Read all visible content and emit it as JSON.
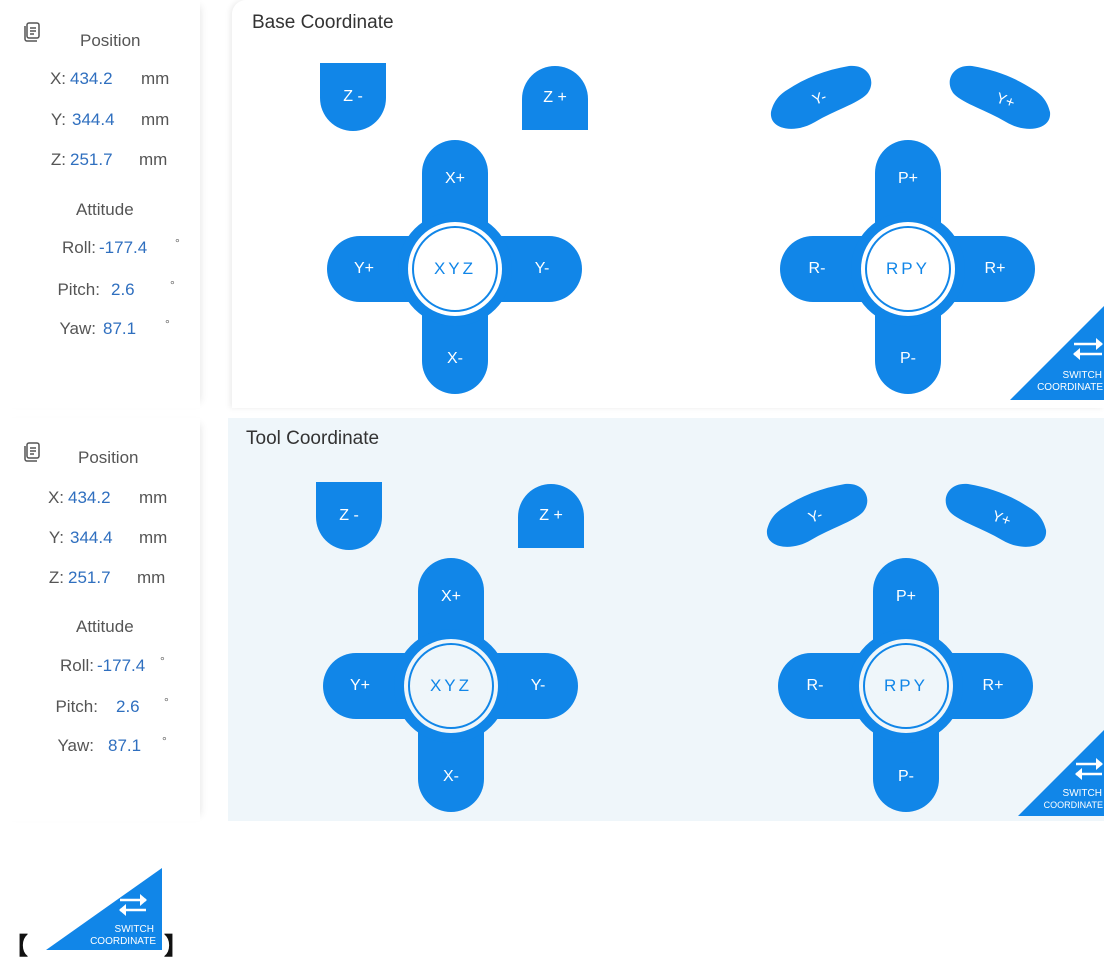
{
  "colors": {
    "accent": "#1186e8",
    "value_text": "#2f6fbf",
    "tool_background": "#eff6fa"
  },
  "panels": [
    {
      "title": "Base Coordinate",
      "side": {
        "position_title": "Position",
        "x_label": "X:",
        "x_value": "434.2",
        "x_unit": "mm",
        "y_label": "Y:",
        "y_value": "344.4",
        "y_unit": "mm",
        "z_label": "Z:",
        "z_value": "251.7",
        "z_unit": "mm",
        "attitude_title": "Attitude",
        "roll_label": "Roll:",
        "roll_value": "-177.4",
        "roll_unit": "°",
        "pitch_label": "Pitch:",
        "pitch_value": "2.6",
        "pitch_unit": "°",
        "yaw_label": "Yaw:",
        "yaw_value": "87.1",
        "yaw_unit": "°"
      },
      "buttons": {
        "z_minus": "Z -",
        "z_plus": "Z +",
        "x_plus": "X+",
        "x_minus": "X-",
        "y_plus": "Y+",
        "y_minus": "Y-",
        "xyz": "XYZ",
        "yaw_minus": "Y-",
        "yaw_plus": "Y+",
        "p_plus": "P+",
        "p_minus": "P-",
        "r_minus": "R-",
        "r_plus": "R+",
        "rpy": "RPY",
        "switch_line1": "SWITCH",
        "switch_line2": "COORDINATE"
      }
    },
    {
      "title": "Tool Coordinate",
      "side": {
        "position_title": "Position",
        "x_label": "X:",
        "x_value": "434.2",
        "x_unit": "mm",
        "y_label": "Y:",
        "y_value": "344.4",
        "y_unit": "mm",
        "z_label": "Z:",
        "z_value": "251.7",
        "z_unit": "mm",
        "attitude_title": "Attitude",
        "roll_label": "Roll:",
        "roll_value": "-177.4",
        "roll_unit": "°",
        "pitch_label": "Pitch:",
        "pitch_value": "2.6",
        "pitch_unit": "°",
        "yaw_label": "Yaw:",
        "yaw_value": "87.1",
        "yaw_unit": "°"
      },
      "buttons": {
        "z_minus": "Z -",
        "z_plus": "Z +",
        "x_plus": "X+",
        "x_minus": "X-",
        "y_plus": "Y+",
        "y_minus": "Y-",
        "xyz": "XYZ",
        "yaw_minus": "Y-",
        "yaw_plus": "Y+",
        "p_plus": "P+",
        "p_minus": "P-",
        "r_minus": "R-",
        "r_plus": "R+",
        "rpy": "RPY",
        "switch_line1": "SWITCH",
        "switch_line2": "COORDINATE"
      }
    }
  ],
  "legend": {
    "bracket_open": "【",
    "bracket_close": "】",
    "switch_line1": "SWITCH",
    "switch_line2": "COORDINATE"
  },
  "icons": {
    "menu": "document-list-icon",
    "switch": "swap-arrows-icon"
  }
}
